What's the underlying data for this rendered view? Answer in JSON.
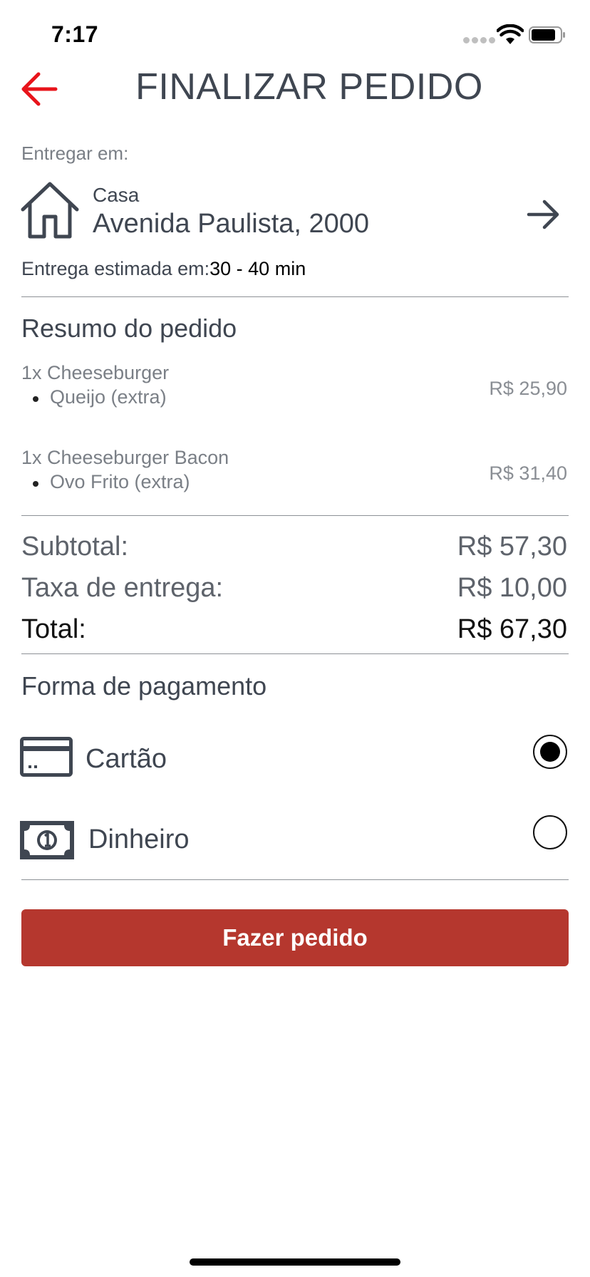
{
  "status_bar": {
    "time": "7:17"
  },
  "header": {
    "title": "FINALIZAR PEDIDO"
  },
  "delivery": {
    "label": "Entregar em:",
    "address_name": "Casa",
    "address_line": "Avenida Paulista, 2000",
    "eta_label": "Entrega estimada em:",
    "eta_value": "30 - 40 min"
  },
  "summary": {
    "title": "Resumo do pedido",
    "items": [
      {
        "name": "1x Cheeseburger",
        "extra": "Queijo (extra)",
        "price": "R$ 25,90"
      },
      {
        "name": "1x Cheeseburger Bacon",
        "extra": "Ovo Frito (extra)",
        "price": "R$ 31,40"
      }
    ]
  },
  "totals": {
    "subtotal_label": "Subtotal:",
    "subtotal_value": "R$ 57,30",
    "fee_label": "Taxa de entrega:",
    "fee_value": "R$ 10,00",
    "total_label": "Total:",
    "total_value": "R$ 67,30"
  },
  "payment": {
    "title": "Forma de pagamento",
    "options": [
      {
        "label": "Cartão",
        "selected": true,
        "icon": "credit-card-icon"
      },
      {
        "label": "Dinheiro",
        "selected": false,
        "icon": "cash-icon"
      }
    ]
  },
  "actions": {
    "order_button": "Fazer pedido"
  },
  "colors": {
    "accent": "#b5372e",
    "back_arrow": "#e8141b",
    "text": "#3f4651"
  }
}
